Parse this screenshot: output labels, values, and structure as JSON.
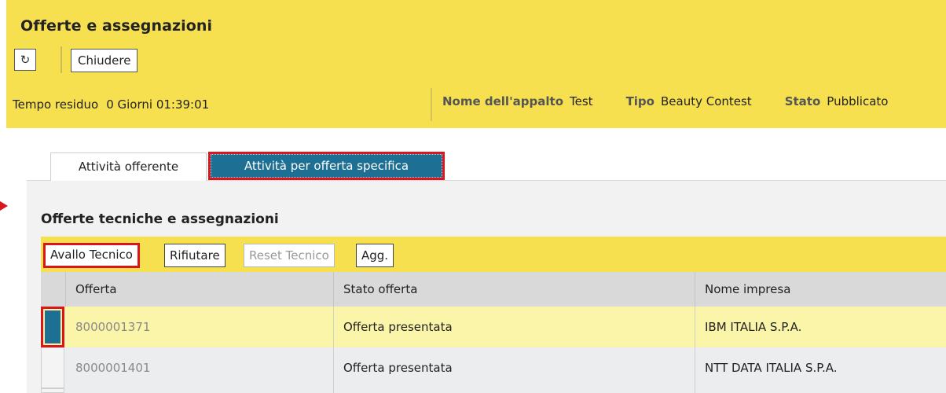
{
  "header": {
    "title": "Offerte e assegnazioni",
    "refresh_icon": "refresh-icon",
    "close_label": "Chiudere",
    "tempo_label": "Tempo residuo",
    "tempo_value": "0 Giorni 01:39:01",
    "nome_label": "Nome dell'appalto",
    "nome_value": "Test",
    "tipo_label": "Tipo",
    "tipo_value": "Beauty Contest",
    "stato_label": "Stato",
    "stato_value": "Pubblicato"
  },
  "tabs": [
    {
      "label": "Attività offerente",
      "active": false
    },
    {
      "label": "Attività per offerta specifica",
      "active": true
    }
  ],
  "section": {
    "title": "Offerte tecniche e assegnazioni"
  },
  "toolbar": {
    "avallo_label": "Avallo Tecnico",
    "rifiutare_label": "Rifiutare",
    "reset_label": "Reset Tecnico",
    "agg_label": "Agg."
  },
  "table": {
    "columns": [
      "Offerta",
      "Stato offerta",
      "Nome impresa"
    ],
    "rows": [
      {
        "offerta": "8000001371",
        "stato": "Offerta presentata",
        "impresa": "IBM ITALIA S.P.A.",
        "selected": true
      },
      {
        "offerta": "8000001401",
        "stato": "Offerta presentata",
        "impresa": "NTT DATA ITALIA S.P.A.",
        "selected": false
      }
    ]
  },
  "colors": {
    "header_yellow": "#f7e04f",
    "accent_blue": "#1d6f93",
    "highlight_red": "#d8161c",
    "row_selected": "#faf5a8"
  }
}
